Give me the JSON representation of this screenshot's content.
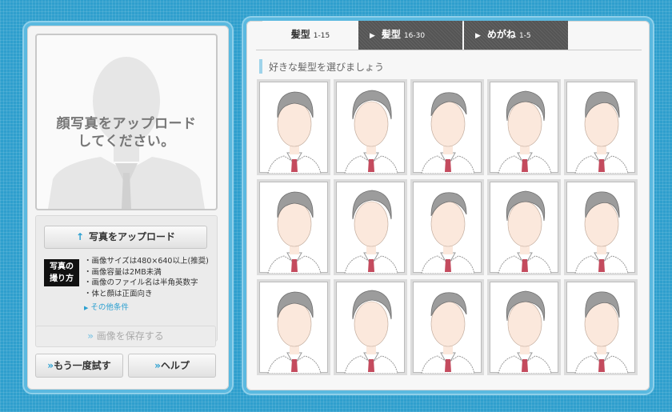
{
  "left_panel": {
    "photo_placeholder_line1": "顔写真をアップロード",
    "photo_placeholder_line2": "してください。",
    "upload_button_label": "写真をアップロード",
    "howto_badge_line1": "写真の",
    "howto_badge_line2": "撮り方",
    "rules": [
      "画像サイズは480×640以上(推奨)",
      "画像容量は2MB未満",
      "画像のファイル名は半角英数字",
      "体と顔は正面向き"
    ],
    "more_conditions_link": "その他条件",
    "save_button_label": "画像を保存する",
    "retry_button_label": "もう一度試す",
    "help_button_label": "ヘルプ"
  },
  "right_panel": {
    "tabs": [
      {
        "label": "髪型",
        "range": "1-15",
        "active": true
      },
      {
        "label": "髪型",
        "range": "16-30",
        "active": false
      },
      {
        "label": "めがね",
        "range": "1-5",
        "active": false
      }
    ],
    "heading": "好きな髪型を選びましょう",
    "hairstyles": [
      {
        "style_id": 1
      },
      {
        "style_id": 2
      },
      {
        "style_id": 3
      },
      {
        "style_id": 4
      },
      {
        "style_id": 5
      },
      {
        "style_id": 6
      },
      {
        "style_id": 7
      },
      {
        "style_id": 8
      },
      {
        "style_id": 9
      },
      {
        "style_id": 10
      },
      {
        "style_id": 11
      },
      {
        "style_id": 12
      },
      {
        "style_id": 13
      },
      {
        "style_id": 14
      },
      {
        "style_id": 15
      }
    ]
  },
  "colors": {
    "background": "#2f9fcd",
    "accent": "#2a9fd0",
    "tab_inactive": "#555555",
    "skin": "#fbe8dc",
    "tie": "#c44b5e"
  },
  "icons": [
    "upload-arrow-icon",
    "double-chevron-icon",
    "triangle-right-icon"
  ]
}
